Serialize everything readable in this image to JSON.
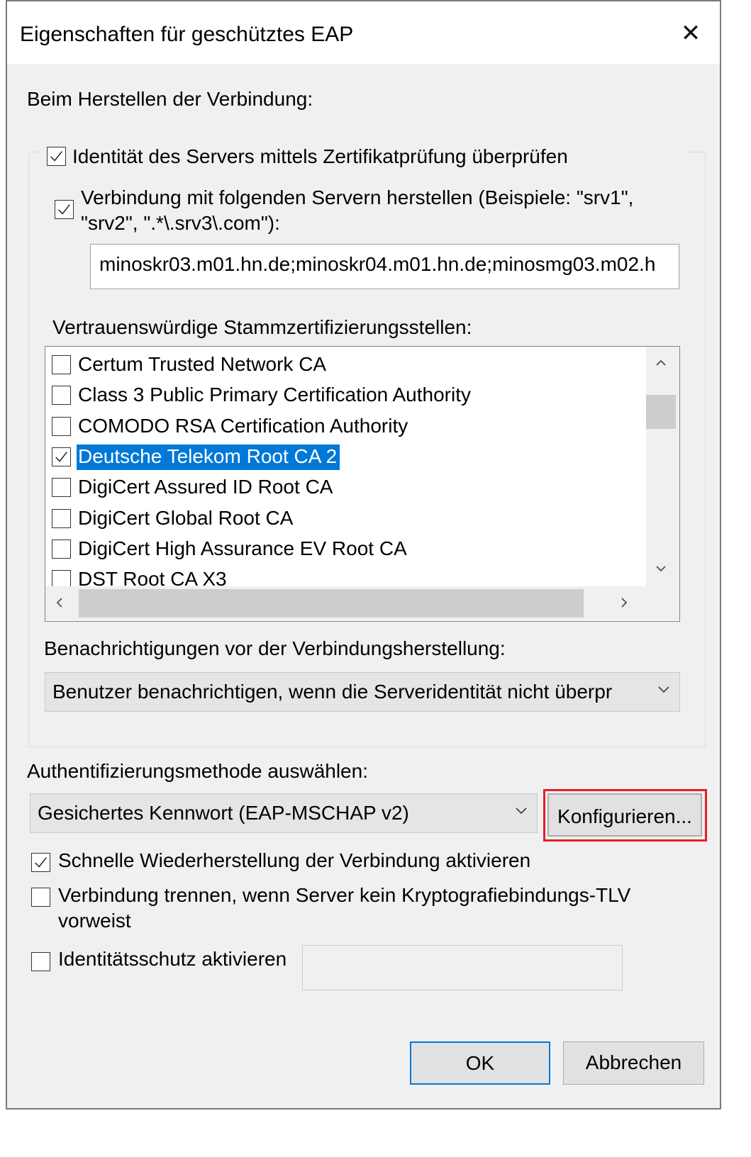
{
  "window": {
    "title": "Eigenschaften für geschütztes EAP",
    "close_icon": "close-icon"
  },
  "connection": {
    "heading": "Beim Herstellen der Verbindung:",
    "verify_identity": {
      "label": "Identität des Servers mittels Zertifikatprüfung überprüfen",
      "checked": true
    },
    "connect_servers": {
      "label_line1": "Verbindung mit folgenden Servern herstellen (Beispiele: \"srv1\",",
      "label_line2": "\"srv2\", \".*\\.srv3\\.com\"):",
      "checked": true
    },
    "servers_value": "minoskr03.m01.hn.de;minoskr04.m01.hn.de;minosmg03.m02.h",
    "trusted_roots_label": "Vertrauenswürdige Stammzertifizierungsstellen:",
    "trusted_roots": [
      {
        "label": "Certum Trusted Network CA",
        "checked": false,
        "selected": false
      },
      {
        "label": "Class 3 Public Primary Certification Authority",
        "checked": false,
        "selected": false
      },
      {
        "label": "COMODO RSA Certification Authority",
        "checked": false,
        "selected": false
      },
      {
        "label": "Deutsche Telekom Root CA 2",
        "checked": true,
        "selected": true
      },
      {
        "label": "DigiCert Assured ID Root CA",
        "checked": false,
        "selected": false
      },
      {
        "label": "DigiCert Global Root CA",
        "checked": false,
        "selected": false
      },
      {
        "label": "DigiCert High Assurance EV Root CA",
        "checked": false,
        "selected": false
      },
      {
        "label": "DST Root CA X3",
        "checked": false,
        "selected": false
      }
    ],
    "notifications_label": "Benachrichtigungen vor der Verbindungsherstellung:",
    "notifications_value": "Benutzer benachrichtigen, wenn die Serveridentität nicht überpr"
  },
  "auth": {
    "label": "Authentifizierungsmethode auswählen:",
    "method_value": "Gesichertes Kennwort (EAP-MSCHAP v2)",
    "configure_button": "Konfigurieren..."
  },
  "options": {
    "fast_reconnect": {
      "label": "Schnelle Wiederherstellung der Verbindung aktivieren",
      "checked": true
    },
    "disconnect_tlv": {
      "label_line1": "Verbindung trennen, wenn Server kein Kryptografiebindungs-TLV",
      "label_line2": "vorweist",
      "checked": false
    },
    "identity_privacy": {
      "label": "Identitätsschutz aktivieren",
      "checked": false,
      "value": ""
    }
  },
  "buttons": {
    "ok": "OK",
    "cancel": "Abbrechen"
  },
  "colors": {
    "selection": "#0078d7",
    "highlight_border": "#e32028"
  }
}
